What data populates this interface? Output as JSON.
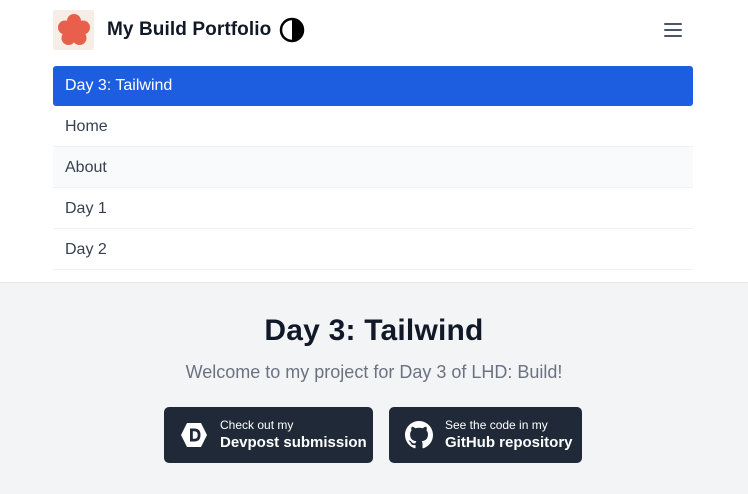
{
  "header": {
    "brand_title": "My Build Portfolio",
    "logo_icon": "flower-logo",
    "theme_toggle_icon": "contrast-icon",
    "menu_icon": "hamburger-icon"
  },
  "nav": {
    "items": [
      {
        "label": "Day 3: Tailwind",
        "active": true
      },
      {
        "label": "Home",
        "active": false
      },
      {
        "label": "About",
        "active": false
      },
      {
        "label": "Day 1",
        "active": false
      },
      {
        "label": "Day 2",
        "active": false
      }
    ]
  },
  "hero": {
    "title": "Day 3: Tailwind",
    "subtitle": "Welcome to my project for Day 3 of LHD: Build!",
    "buttons": [
      {
        "small": "Check out my",
        "big": "Devpost submission",
        "icon": "devpost-icon"
      },
      {
        "small": "See the code in my",
        "big": "GitHub repository",
        "icon": "github-icon"
      }
    ]
  },
  "colors": {
    "accent": "#1d5ee0",
    "logo": "#e8604c",
    "button_bg": "#1f2937"
  }
}
